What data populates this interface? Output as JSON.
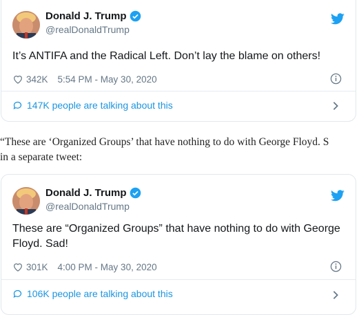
{
  "tweets": [
    {
      "name": "Donald J. Trump",
      "handle": "@realDonaldTrump",
      "text": "It’s ANTIFA and the Radical Left. Don’t lay the blame on others!",
      "likes": "342K",
      "time": "5:54 PM - May 30, 2020",
      "talking": "147K people are talking about this"
    },
    {
      "name": "Donald J. Trump",
      "handle": "@realDonaldTrump",
      "text": "These are “Organized Groups” that have nothing to do with George Floyd. Sad!",
      "likes": "301K",
      "time": "4:00 PM - May 30, 2020",
      "talking": "106K people are talking about this"
    }
  ],
  "article": {
    "line1": "“These are ‘Organized Groups’ that have nothing to do with George Floyd. S",
    "line2": "in a separate tweet:"
  },
  "colors": {
    "accent": "#1da1f2",
    "link": "#1b95e0",
    "verified": "#1da1f2",
    "muted": "#657786"
  },
  "icons": [
    "avatar",
    "verified-badge-icon",
    "twitter-bird-icon",
    "heart-icon",
    "info-icon",
    "speech-bubble-icon",
    "chevron-right-icon"
  ]
}
